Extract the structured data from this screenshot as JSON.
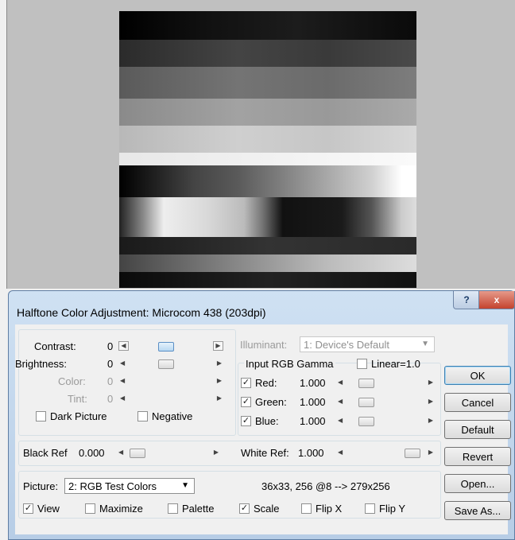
{
  "dialog": {
    "title": "Halftone Color Adjustment: Microcom 438 (203dpi)",
    "help_label": "?",
    "close_label": "x"
  },
  "color_group": {
    "contrast_label": "Contrast:",
    "contrast_value": "0",
    "brightness_label": "Brightness:",
    "brightness_value": "0",
    "color_label": "Color:",
    "color_value": "0",
    "tint_label": "Tint:",
    "tint_value": "0",
    "dark_picture_label": "Dark Picture",
    "negative_label": "Negative"
  },
  "illuminant": {
    "label": "Illuminant:",
    "value": "1: Device's Default"
  },
  "gamma": {
    "title": "Input RGB Gamma",
    "linear_label": "Linear=1.0",
    "red_label": "Red:",
    "red_value": "1.000",
    "green_label": "Green:",
    "green_value": "1.000",
    "blue_label": "Blue:",
    "blue_value": "1.000"
  },
  "refs": {
    "black_label": "Black Ref",
    "black_value": "0.000",
    "white_label": "White Ref:",
    "white_value": "1.000"
  },
  "picture": {
    "label": "Picture:",
    "selected": "2: RGB Test Colors",
    "info": "36x33, 256 @8 --> 279x256",
    "view_label": "View",
    "maximize_label": "Maximize",
    "palette_label": "Palette",
    "scale_label": "Scale",
    "flipx_label": "Flip X",
    "flipy_label": "Flip Y"
  },
  "buttons": {
    "ok": "OK",
    "cancel": "Cancel",
    "default": "Default",
    "revert": "Revert",
    "open": "Open...",
    "save_as": "Save As..."
  },
  "checked": {
    "red": true,
    "green": true,
    "blue": true,
    "view": true,
    "scale": true,
    "dark_picture": false,
    "negative": false,
    "linear": false,
    "maximize": false,
    "palette": false,
    "flip_x": false,
    "flip_y": false
  },
  "icons": [
    "arrow-left-icon",
    "arrow-right-icon",
    "dropdown-arrow-icon",
    "help-icon",
    "close-icon",
    "checkmark-icon"
  ]
}
